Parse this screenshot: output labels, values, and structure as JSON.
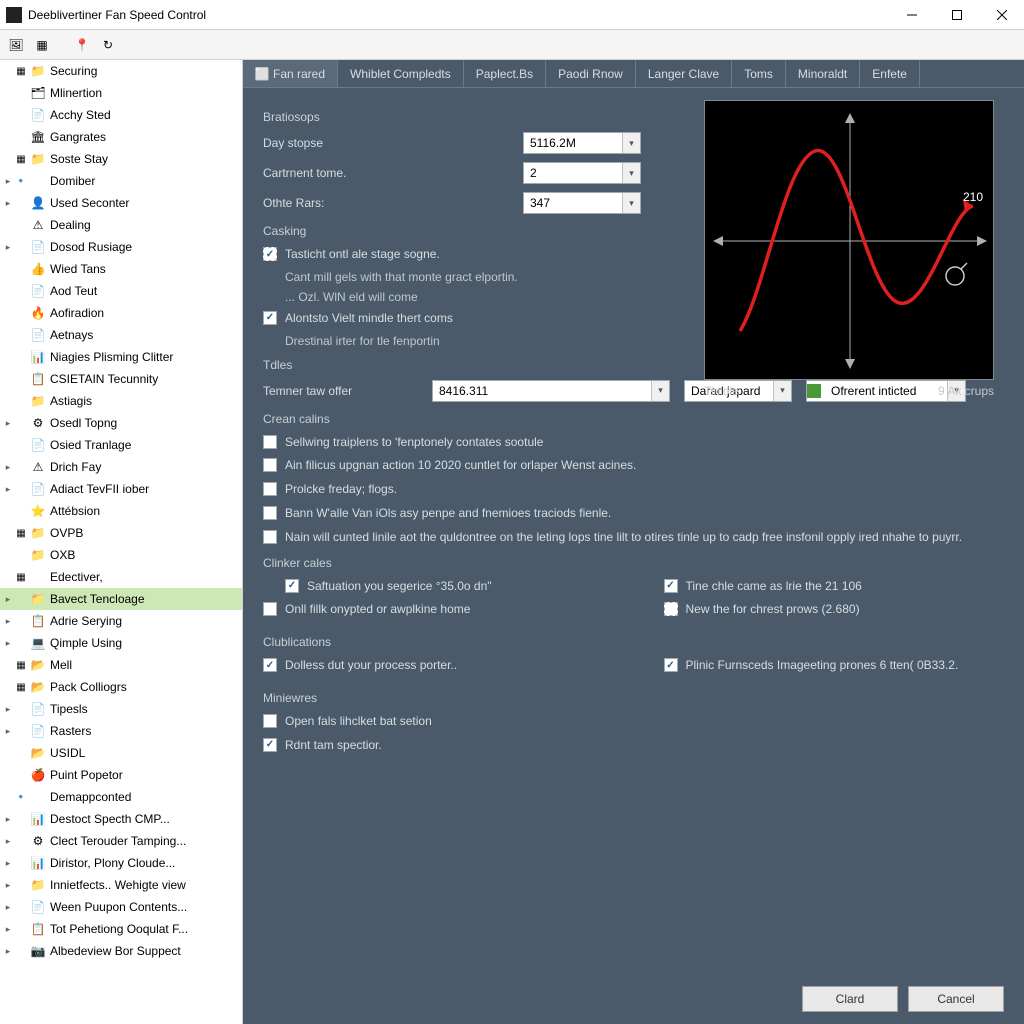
{
  "window": {
    "title": "Deeblivertiner Fan Speed Control"
  },
  "toolbar_icons": [
    "photo",
    "grid",
    "pin",
    "refresh"
  ],
  "sidebar": [
    {
      "exp": "",
      "pre": "▦",
      "ico": "📁",
      "label": "Securing"
    },
    {
      "exp": "",
      "pre": "",
      "ico": "🗂",
      "label": "Mlinertion"
    },
    {
      "exp": "",
      "pre": "",
      "ico": "📄",
      "label": "Acchy Sted"
    },
    {
      "exp": "",
      "pre": "",
      "ico": "🏛",
      "label": "Gangrates"
    },
    {
      "exp": "",
      "pre": "▦",
      "ico": "📁",
      "label": "Soste Stay"
    },
    {
      "exp": "▸",
      "pre": "🔹",
      "ico": "",
      "label": "Domiber"
    },
    {
      "exp": "▸",
      "pre": "",
      "ico": "👤",
      "label": "Used Seconter"
    },
    {
      "exp": "",
      "pre": "",
      "ico": "⚠",
      "label": "Dealing"
    },
    {
      "exp": "▸",
      "pre": "",
      "ico": "📄",
      "label": "Dosod Rusiage"
    },
    {
      "exp": "",
      "pre": "",
      "ico": "👍",
      "label": "Wied Tans"
    },
    {
      "exp": "",
      "pre": "",
      "ico": "📄",
      "label": "Aod Teut"
    },
    {
      "exp": "",
      "pre": "",
      "ico": "🔥",
      "label": "Aofiradion"
    },
    {
      "exp": "",
      "pre": "",
      "ico": "📄",
      "label": "Aetnays"
    },
    {
      "exp": "",
      "pre": "",
      "ico": "📊",
      "label": "Niagies Plisming Clitter"
    },
    {
      "exp": "",
      "pre": "",
      "ico": "📋",
      "label": "CSIETAIN Tecunnity"
    },
    {
      "exp": "",
      "pre": "",
      "ico": "📁",
      "label": "Astiagis"
    },
    {
      "exp": "▸",
      "pre": "",
      "ico": "⚙",
      "label": "Osedl Topng"
    },
    {
      "exp": "",
      "pre": "",
      "ico": "📄",
      "label": "Osied Tranlage"
    },
    {
      "exp": "▸",
      "pre": "",
      "ico": "⚠",
      "label": "Drich Fay"
    },
    {
      "exp": "▸",
      "pre": "",
      "ico": "📄",
      "label": "Adiact TevFII iober"
    },
    {
      "exp": "",
      "pre": "",
      "ico": "⭐",
      "label": "Attébsion"
    },
    {
      "exp": "",
      "pre": "▦",
      "ico": "📁",
      "label": "OVPB"
    },
    {
      "exp": "",
      "pre": "",
      "ico": "📁",
      "label": "OXB"
    },
    {
      "exp": "",
      "pre": "▦",
      "ico": "",
      "label": "Edectiver,"
    },
    {
      "exp": "▸",
      "pre": "",
      "ico": "📁",
      "label": "Bavect Tencloage",
      "selected": true
    },
    {
      "exp": "▸",
      "pre": "",
      "ico": "📋",
      "label": "Adrie Serying"
    },
    {
      "exp": "▸",
      "pre": "",
      "ico": "💻",
      "label": "Qimple Using"
    },
    {
      "exp": "",
      "pre": "▦",
      "ico": "📂",
      "label": "Mell"
    },
    {
      "exp": "",
      "pre": "▦",
      "ico": "📂",
      "label": "Pack Colliogrs"
    },
    {
      "exp": "▸",
      "pre": "",
      "ico": "📄",
      "label": "Tipesls"
    },
    {
      "exp": "▸",
      "pre": "",
      "ico": "📄",
      "label": "Rasters"
    },
    {
      "exp": "",
      "pre": "",
      "ico": "📂",
      "label": "USIDL"
    },
    {
      "exp": "",
      "pre": "",
      "ico": "🍎",
      "label": "Puint Popetor"
    },
    {
      "exp": "",
      "pre": "🔹",
      "ico": "",
      "label": "Demappconted"
    },
    {
      "exp": "▸",
      "pre": "",
      "ico": "📊",
      "label": "Destoct Specth CMP..."
    },
    {
      "exp": "▸",
      "pre": "",
      "ico": "⚙",
      "label": "Clect Terouder Tamping..."
    },
    {
      "exp": "▸",
      "pre": "",
      "ico": "📊",
      "label": "Diristor, Plony Cloude..."
    },
    {
      "exp": "▸",
      "pre": "",
      "ico": "📁",
      "label": "Innietfects.. Wehigte view"
    },
    {
      "exp": "▸",
      "pre": "",
      "ico": "📄",
      "label": "Ween Puupon Contents..."
    },
    {
      "exp": "▸",
      "pre": "",
      "ico": "📋",
      "label": "Tot Pehetiong Ooqulat F..."
    },
    {
      "exp": "▸",
      "pre": "",
      "ico": "📷",
      "label": "Albedeview Bor Suppect"
    }
  ],
  "tabs": [
    {
      "label": "Fan rared",
      "active": true,
      "ico": "⬜"
    },
    {
      "label": "Whiblet Compledts"
    },
    {
      "label": "Paplect.Bs"
    },
    {
      "label": "Paodi Rnow"
    },
    {
      "label": "Langer Clave"
    },
    {
      "label": "Toms"
    },
    {
      "label": "Minoraldt"
    },
    {
      "label": "Enfete"
    }
  ],
  "bratiosops": {
    "title": "Bratiosops",
    "day_label": "Day stopse",
    "day_value": "5116.2M",
    "cart_label": "Cartrnent tome.",
    "cart_value": "2",
    "other_label": "Othte Rars:",
    "other_value": "347"
  },
  "casking": {
    "title": "Casking",
    "c1": "Tasticht ontl ale stage sogne.",
    "note1": "Cant mill gels with that monte gract elportin.",
    "note2": "... Ozl. WlN eld will come",
    "c2": "Alontsto Vielt mindle thert coms",
    "note3": "Drestinal irter for tle fenportin"
  },
  "tdles": {
    "title": "Tdles",
    "temner_label": "Temner taw offer",
    "temner_value": "8416.311",
    "dd2": "Darad japard",
    "dd3": "Ofrerent inticted"
  },
  "crean": {
    "title": "Crean calins",
    "c1": "Sellwing traiplens to 'fenptonely contates sootule",
    "c2": "Ain filicus upgnan action 10 2020 cuntlet for orlaper Wenst acines.",
    "c3": "Prolcke freday; flogs.",
    "c4": "Bann W'alle Van iOls asy penpe and fnemioes traciods fienle.",
    "c5": "Nain will cunted linile aot the quldontree on the leting lops tine lilt to otires tinle up to cadp free insfonil opply ired nhahe to puyrr."
  },
  "clinker": {
    "title": "Clinker cales",
    "left1": "Saftuation you segerice °35.0o dn\"",
    "left2": "Onll fillk onypted or awplkine home",
    "right1": "Tine chle came as lrie the 21 106",
    "right2": "New the for chrest prows (2.680)"
  },
  "club": {
    "title": "Clublications",
    "c1": "Dolless dut your process porter..",
    "c2": "Plinic Furnsceds Imageeting prones 6 tten( 0B33.2."
  },
  "mini": {
    "title": "Miniewres",
    "c1": "Open fals lihclket bat setion",
    "c2": "Rdnt tam spectior."
  },
  "buttons": {
    "clard": "Clard",
    "cancel": "Cancel"
  },
  "graph": {
    "left_caption": "Tiniole",
    "right_caption": "9 Ak crups",
    "label210": "210"
  }
}
